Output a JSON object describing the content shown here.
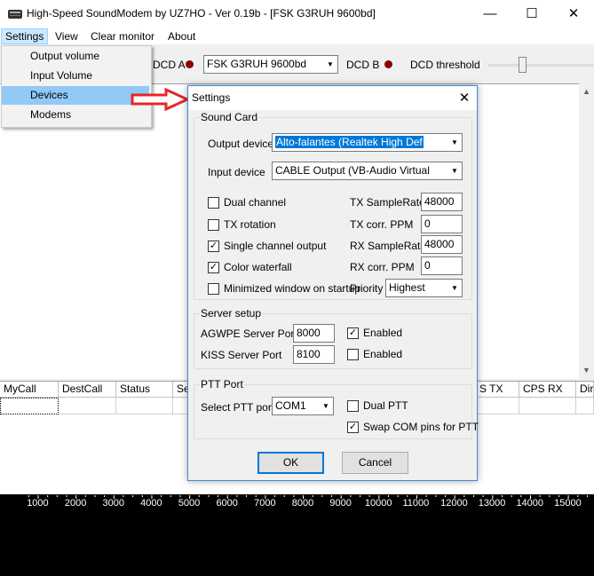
{
  "window": {
    "title": "High-Speed SoundModem by UZ7HO - Ver 0.19b - [FSK G3RUH 9600bd]",
    "minimize": "—",
    "maximize": "☐",
    "close": "✕"
  },
  "menu": {
    "settings": "Settings",
    "view": "View",
    "clear_monitor": "Clear monitor",
    "about": "About"
  },
  "settings_menu": {
    "items": [
      "Output volume",
      "Input Volume",
      "Devices",
      "Modems"
    ],
    "highlighted": "Devices"
  },
  "toolbar": {
    "dcd_a": "DCD A",
    "modem_a": "FSK G3RUH 9600bd",
    "dcd_b": "DCD B",
    "dcd_threshold": "DCD threshold",
    "led_color": "#8b0000"
  },
  "grid": {
    "columns": [
      "MyCall",
      "DestCall",
      "Status",
      "Se",
      "S TX",
      "CPS RX",
      "Dir"
    ]
  },
  "waterfall": {
    "frequencies": [
      "1000",
      "2000",
      "3000",
      "4000",
      "5000",
      "6000",
      "7000",
      "8000",
      "9000",
      "10000",
      "11000",
      "12000",
      "13000",
      "14000",
      "15000"
    ]
  },
  "dialog": {
    "title": "Settings",
    "close": "✕",
    "sound_card": {
      "title": "Sound Card",
      "output_device_label": "Output device",
      "output_device": "Alto-falantes (Realtek High Def",
      "input_device_label": "Input device",
      "input_device": "CABLE Output (VB-Audio Virtual",
      "dual_channel": "Dual channel",
      "tx_rotation": "TX rotation",
      "single_channel_output": "Single channel output",
      "color_waterfall": "Color waterfall",
      "minimized_window": "Minimized window on startup",
      "tx_samplerate_label": "TX SampleRate",
      "tx_samplerate": "48000",
      "tx_corr_label": "TX corr. PPM",
      "tx_corr": "0",
      "rx_samplerate_label": "RX SampleRate",
      "rx_samplerate": "48000",
      "rx_corr_label": "RX corr. PPM",
      "rx_corr": "0",
      "priority_label": "Priority",
      "priority": "Highest",
      "checked": {
        "dual_channel": false,
        "tx_rotation": false,
        "single_channel_output": true,
        "color_waterfall": true,
        "minimized_window": false
      }
    },
    "server_setup": {
      "title": "Server setup",
      "agwpe_label": "AGWPE Server Port",
      "agwpe_port": "8000",
      "agwpe_enabled": "Enabled",
      "kiss_label": "KISS Server Port",
      "kiss_port": "8100",
      "kiss_enabled": "Enabled",
      "checked": {
        "agwpe": true,
        "kiss": false
      }
    },
    "ptt_port": {
      "title": "PTT Port",
      "select_label": "Select PTT port",
      "port": "COM1",
      "dual_ptt": "Dual PTT",
      "swap_com": "Swap COM pins for PTT",
      "checked": {
        "dual_ptt": false,
        "swap_com": true
      }
    },
    "ok": "OK",
    "cancel": "Cancel"
  },
  "glyphs": {
    "check": "✓",
    "combo_arrow": "▼",
    "up_arrow": "▲",
    "down_arrow": "▼"
  },
  "colors": {
    "arrow": "#e8262a",
    "selection": "#0078d7",
    "menu_highlight": "#91c9f7",
    "dialog_border": "#3a8ad9"
  }
}
